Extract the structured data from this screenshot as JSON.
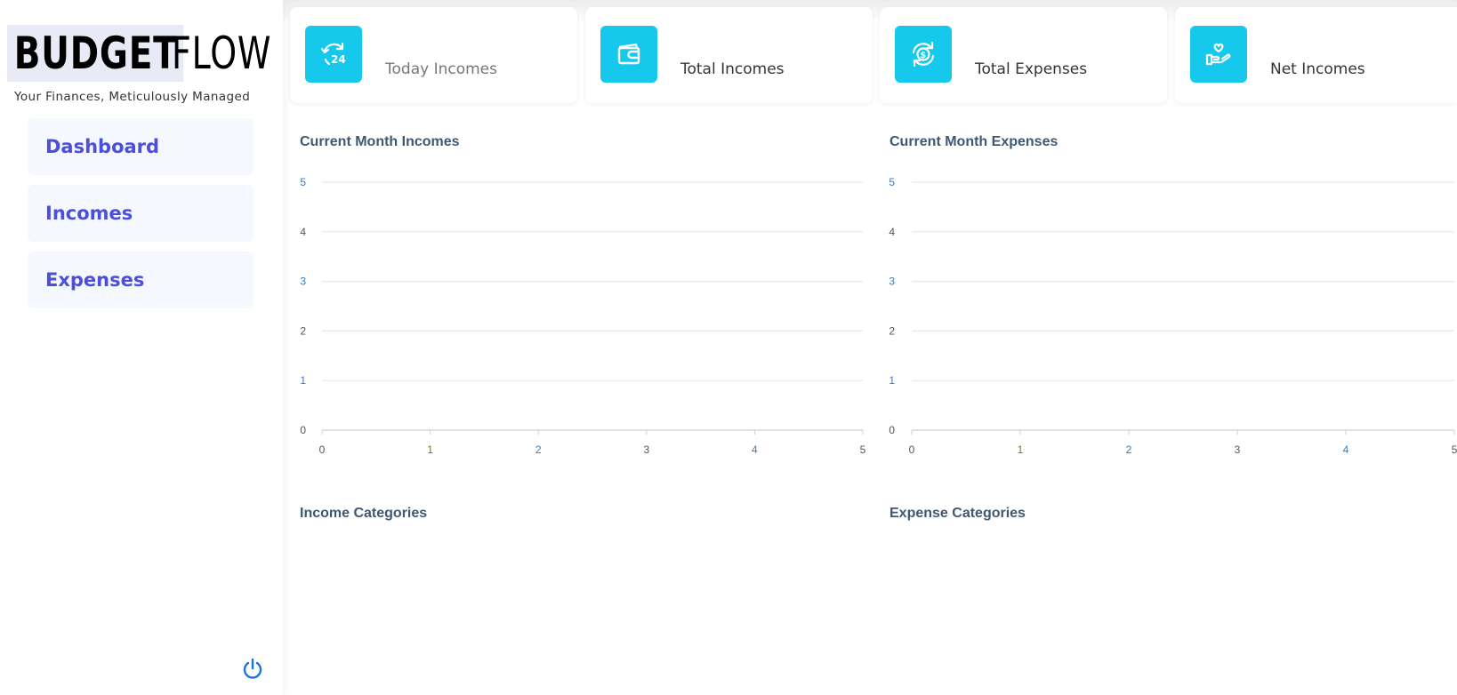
{
  "brand": {
    "word1": "BUDGET",
    "word2": "FLOW",
    "tagline": "Your Finances, Meticulously Managed"
  },
  "sidebar": {
    "items": [
      {
        "label": "Dashboard"
      },
      {
        "label": "Incomes"
      },
      {
        "label": "Expenses"
      }
    ],
    "logout_icon": "power-icon"
  },
  "cards": [
    {
      "label": "Today Incomes",
      "icon": "24h-refresh-icon"
    },
    {
      "label": "Total Incomes",
      "icon": "wallet-icon"
    },
    {
      "label": "Total Expenses",
      "icon": "dollar-cycle-icon"
    },
    {
      "label": "Net Incomes",
      "icon": "hand-heart-icon"
    }
  ],
  "colors": {
    "accent": "#16c8ec",
    "nav_text": "#4c4fdc",
    "nav_bg": "#f5f8fe",
    "section_title": "#3e5873"
  },
  "sections": {
    "month_incomes": "Current Month Incomes",
    "month_expenses": "Current Month Expenses",
    "income_categories": "Income Categories",
    "expense_categories": "Expense Categories"
  },
  "chart_data": [
    {
      "type": "line",
      "title": "Current Month Incomes",
      "x": [],
      "series": [],
      "xlim": [
        0,
        5
      ],
      "ylim": [
        0,
        5
      ],
      "xticks": [
        "0",
        "1",
        "2",
        "3",
        "4",
        "5"
      ],
      "yticks": [
        "0",
        "1",
        "2",
        "3",
        "4",
        "5"
      ],
      "grid": true
    },
    {
      "type": "line",
      "title": "Current Month Expenses",
      "x": [],
      "series": [],
      "xlim": [
        0,
        5
      ],
      "ylim": [
        0,
        5
      ],
      "xticks": [
        "0",
        "1",
        "2",
        "3",
        "4",
        "5"
      ],
      "yticks": [
        "0",
        "1",
        "2",
        "3",
        "4",
        "5"
      ],
      "grid": true
    }
  ]
}
